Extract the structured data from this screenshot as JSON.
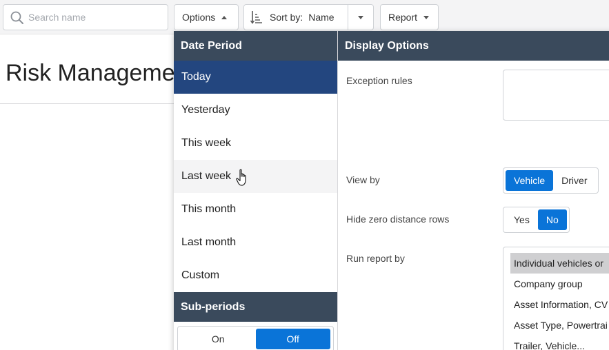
{
  "search": {
    "placeholder": "Search name"
  },
  "toolbar": {
    "options_label": "Options",
    "sort_prefix": "Sort by:",
    "sort_value": "Name",
    "report_label": "Report"
  },
  "page": {
    "title": "Risk Managemen"
  },
  "date_period": {
    "heading": "Date Period",
    "items": [
      "Today",
      "Yesterday",
      "This week",
      "Last week",
      "This month",
      "Last month",
      "Custom"
    ],
    "selected": "Today",
    "hovered": "Last week"
  },
  "sub_periods": {
    "heading": "Sub-periods",
    "on_label": "On",
    "off_label": "Off",
    "selected": "Off"
  },
  "display_options": {
    "heading": "Display Options",
    "exception_rules_label": "Exception rules",
    "view_by": {
      "label": "View by",
      "vehicle": "Vehicle",
      "driver": "Driver",
      "selected": "Vehicle"
    },
    "hide_zero": {
      "label": "Hide zero distance rows",
      "yes": "Yes",
      "no": "No",
      "selected": "No"
    },
    "run_report_by": {
      "label": "Run report by",
      "items": [
        "Individual vehicles or",
        "Company group",
        "Asset Information, CV",
        "Asset Type, Powertrai",
        "Trailer, Vehicle..."
      ],
      "selected": "Individual vehicles or"
    }
  },
  "colors": {
    "header_dark": "#3a4a5c",
    "selected_navy": "#23467f",
    "accent_blue": "#0a74d8"
  }
}
